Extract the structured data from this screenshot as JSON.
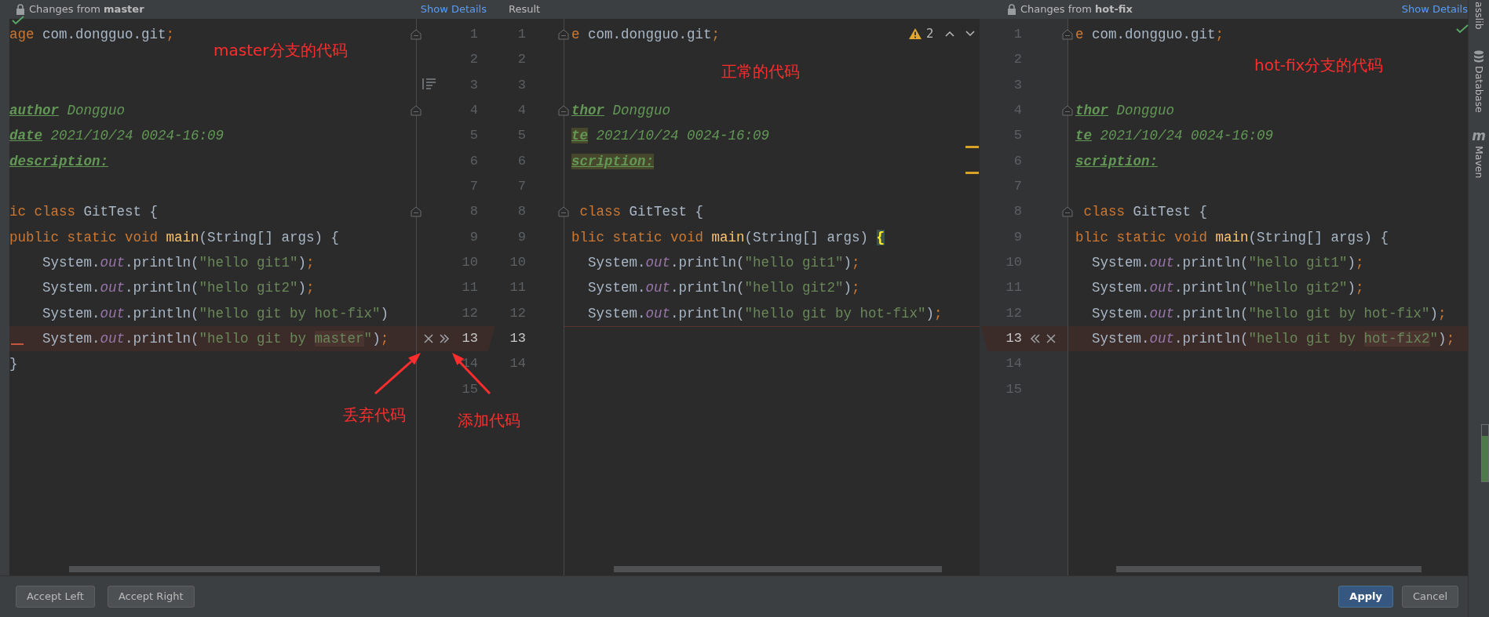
{
  "left_header": {
    "title": "Changes from **master**",
    "link": "Show Details"
  },
  "result_header": {
    "title": "Result"
  },
  "right_header": {
    "title": "Changes from **hot-fix**",
    "link": "Show Details"
  },
  "left_pane": {
    "lines": [
      {
        "fold": true,
        "conflict": false,
        "segments": [
          {
            "text": "age",
            "kind": "kw"
          },
          {
            "text": " com.dongguo.git",
            "kind": "plain"
          },
          {
            "text": ";",
            "kind": "punct"
          }
        ]
      },
      {
        "fold": false,
        "conflict": false
      },
      {
        "fold": false,
        "conflict": false
      },
      {
        "fold": true,
        "conflict": false,
        "segments": [
          {
            "text": "author",
            "kind": "doctag"
          },
          {
            "text": " Dongguo",
            "kind": "doc"
          }
        ]
      },
      {
        "fold": false,
        "conflict": false,
        "segments": [
          {
            "text": "date",
            "kind": "doctag"
          },
          {
            "text": " 2021/10/24 0024-16:09",
            "kind": "doc"
          }
        ]
      },
      {
        "fold": false,
        "conflict": false,
        "segments": [
          {
            "text": "description:",
            "kind": "doctag"
          }
        ]
      },
      {
        "fold": false,
        "conflict": false
      },
      {
        "fold": true,
        "conflict": false,
        "segments": [
          {
            "text": "ic class ",
            "kind": "kw"
          },
          {
            "text": "GitTest {",
            "kind": "plain"
          }
        ]
      },
      {
        "fold": false,
        "conflict": false,
        "segments": [
          {
            "text": "public static void ",
            "kind": "kw"
          },
          {
            "text": "main",
            "kind": "fn"
          },
          {
            "text": "(String[] args) {",
            "kind": "plain"
          }
        ]
      },
      {
        "fold": false,
        "conflict": false,
        "segments": [
          {
            "text": "    System.",
            "kind": "plain"
          },
          {
            "text": "out",
            "kind": "field"
          },
          {
            "text": ".println(",
            "kind": "plain"
          },
          {
            "text": "\"hello git1\"",
            "kind": "str"
          },
          {
            "text": ")",
            "kind": "plain"
          },
          {
            "text": ";",
            "kind": "punct"
          }
        ]
      },
      {
        "fold": false,
        "conflict": false,
        "segments": [
          {
            "text": "    System.",
            "kind": "plain"
          },
          {
            "text": "out",
            "kind": "field"
          },
          {
            "text": ".println(",
            "kind": "plain"
          },
          {
            "text": "\"hello git2\"",
            "kind": "str"
          },
          {
            "text": ")",
            "kind": "plain"
          },
          {
            "text": ";",
            "kind": "punct"
          }
        ]
      },
      {
        "fold": false,
        "conflict": false,
        "segments": [
          {
            "text": "    System.",
            "kind": "plain"
          },
          {
            "text": "out",
            "kind": "field"
          },
          {
            "text": ".println(",
            "kind": "plain"
          },
          {
            "text": "\"hello git by hot-fix\"",
            "kind": "str"
          },
          {
            "text": ")",
            "kind": "plain"
          }
        ]
      },
      {
        "fold": false,
        "conflict": true,
        "segments": [
          {
            "text": "    System.",
            "kind": "plain"
          },
          {
            "text": "out",
            "kind": "field"
          },
          {
            "text": ".println(",
            "kind": "plain"
          },
          {
            "text": "\"hello git by ",
            "kind": "str"
          },
          {
            "text": "master",
            "kind": "strmark"
          },
          {
            "text": "\"",
            "kind": "str"
          },
          {
            "text": ")",
            "kind": "plain"
          },
          {
            "text": ";",
            "kind": "punct"
          }
        ]
      },
      {
        "fold": false,
        "conflict": false,
        "segments": [
          {
            "text": "}",
            "kind": "plain"
          }
        ]
      }
    ]
  },
  "left_gutter": {
    "rows": [
      {
        "left_no": "1",
        "result_no": "1",
        "conflict": false
      },
      {
        "left_no": "2",
        "result_no": "2",
        "conflict": false
      },
      {
        "left_no": "3",
        "result_no": "3",
        "conflict": false
      },
      {
        "left_no": "4",
        "result_no": "4",
        "conflict": false
      },
      {
        "left_no": "5",
        "result_no": "5",
        "conflict": false
      },
      {
        "left_no": "6",
        "result_no": "6",
        "conflict": false
      },
      {
        "left_no": "7",
        "result_no": "7",
        "conflict": false
      },
      {
        "left_no": "8",
        "result_no": "8",
        "conflict": false
      },
      {
        "left_no": "9",
        "result_no": "9",
        "conflict": false
      },
      {
        "left_no": "10",
        "result_no": "10",
        "conflict": false
      },
      {
        "left_no": "11",
        "result_no": "11",
        "conflict": false
      },
      {
        "left_no": "12",
        "result_no": "12",
        "conflict": false
      },
      {
        "left_no": "13",
        "result_no": "13",
        "conflict": true
      },
      {
        "left_no": "14",
        "result_no": "14",
        "conflict": false
      },
      {
        "left_no": "15",
        "conflict": false
      }
    ]
  },
  "result_pane": {
    "warnings": "2",
    "lines": [
      {
        "fold": true,
        "conflict": false,
        "marked": false,
        "segments": [
          {
            "text": "e",
            "kind": "kw"
          },
          {
            "text": " com.dongguo.git",
            "kind": "plain"
          },
          {
            "text": ";",
            "kind": "punct"
          }
        ]
      },
      {
        "fold": false,
        "conflict": false,
        "marked": false
      },
      {
        "fold": false,
        "conflict": false,
        "marked": false
      },
      {
        "fold": true,
        "conflict": false,
        "marked": false,
        "segments": [
          {
            "text": "thor",
            "kind": "doctag"
          },
          {
            "text": " Dongguo",
            "kind": "doc"
          }
        ]
      },
      {
        "fold": false,
        "conflict": false,
        "marked": true,
        "segments": [
          {
            "text": "te",
            "kind": "doctagmark"
          },
          {
            "text": " 2021/10/24 0024-16:09",
            "kind": "doc"
          }
        ]
      },
      {
        "fold": false,
        "conflict": false,
        "marked": true,
        "segments": [
          {
            "text": "scription:",
            "kind": "doctagmark"
          }
        ]
      },
      {
        "fold": false,
        "conflict": false,
        "marked": false
      },
      {
        "fold": true,
        "conflict": false,
        "marked": false,
        "segments": [
          {
            "text": " class ",
            "kind": "kw"
          },
          {
            "text": "GitTest {",
            "kind": "plain"
          }
        ]
      },
      {
        "fold": false,
        "conflict": false,
        "marked": false,
        "segments": [
          {
            "text": "blic static void ",
            "kind": "kw"
          },
          {
            "text": "main",
            "kind": "fn"
          },
          {
            "text": "(String[] args) ",
            "kind": "plain"
          },
          {
            "text": "{",
            "kind": "brace"
          }
        ]
      },
      {
        "fold": false,
        "conflict": false,
        "marked": false,
        "segments": [
          {
            "text": "  System.",
            "kind": "plain"
          },
          {
            "text": "out",
            "kind": "field"
          },
          {
            "text": ".println(",
            "kind": "plain"
          },
          {
            "text": "\"hello git1\"",
            "kind": "str"
          },
          {
            "text": ")",
            "kind": "plain"
          },
          {
            "text": ";",
            "kind": "punct"
          }
        ]
      },
      {
        "fold": false,
        "conflict": false,
        "marked": false,
        "segments": [
          {
            "text": "  System.",
            "kind": "plain"
          },
          {
            "text": "out",
            "kind": "field"
          },
          {
            "text": ".println(",
            "kind": "plain"
          },
          {
            "text": "\"hello git2\"",
            "kind": "str"
          },
          {
            "text": ")",
            "kind": "plain"
          },
          {
            "text": ";",
            "kind": "punct"
          }
        ]
      },
      {
        "fold": false,
        "conflict": false,
        "marked": false,
        "segments": [
          {
            "text": "  System.",
            "kind": "plain"
          },
          {
            "text": "out",
            "kind": "field"
          },
          {
            "text": ".println(",
            "kind": "plain"
          },
          {
            "text": "\"hello git by hot-fix\"",
            "kind": "str"
          },
          {
            "text": ")",
            "kind": "plain"
          },
          {
            "text": ";",
            "kind": "punct"
          }
        ]
      },
      {
        "fold": false,
        "conflict": true,
        "marked": false
      }
    ]
  },
  "right_gutter": {
    "rows": [
      {
        "no": "1",
        "conflict": false
      },
      {
        "no": "2",
        "conflict": false
      },
      {
        "no": "3",
        "conflict": false
      },
      {
        "no": "4",
        "conflict": false
      },
      {
        "no": "5",
        "conflict": false
      },
      {
        "no": "6",
        "conflict": false
      },
      {
        "no": "7",
        "conflict": false
      },
      {
        "no": "8",
        "conflict": false
      },
      {
        "no": "9",
        "conflict": false
      },
      {
        "no": "10",
        "conflict": false
      },
      {
        "no": "11",
        "conflict": false
      },
      {
        "no": "12",
        "conflict": false
      },
      {
        "no": "13",
        "conflict": true
      },
      {
        "no": "14",
        "conflict": false
      },
      {
        "no": "15",
        "conflict": false
      }
    ]
  },
  "right_pane": {
    "lines": [
      {
        "fold": true,
        "conflict": false,
        "segments": [
          {
            "text": "e",
            "kind": "kw"
          },
          {
            "text": " com.dongguo.git",
            "kind": "plain"
          },
          {
            "text": ";",
            "kind": "punct"
          }
        ]
      },
      {
        "fold": false,
        "conflict": false
      },
      {
        "fold": false,
        "conflict": false
      },
      {
        "fold": true,
        "conflict": false,
        "segments": [
          {
            "text": "thor",
            "kind": "doctag"
          },
          {
            "text": " Dongguo",
            "kind": "doc"
          }
        ]
      },
      {
        "fold": false,
        "conflict": false,
        "segments": [
          {
            "text": "te",
            "kind": "doctag"
          },
          {
            "text": " 2021/10/24 0024-16:09",
            "kind": "doc"
          }
        ]
      },
      {
        "fold": false,
        "conflict": false,
        "segments": [
          {
            "text": "scription:",
            "kind": "doctag"
          }
        ]
      },
      {
        "fold": false,
        "conflict": false
      },
      {
        "fold": true,
        "conflict": false,
        "segments": [
          {
            "text": " class ",
            "kind": "kw"
          },
          {
            "text": "GitTest {",
            "kind": "plain"
          }
        ]
      },
      {
        "fold": false,
        "conflict": false,
        "segments": [
          {
            "text": "blic static void ",
            "kind": "kw"
          },
          {
            "text": "main",
            "kind": "fn"
          },
          {
            "text": "(String[] args) {",
            "kind": "plain"
          }
        ]
      },
      {
        "fold": false,
        "conflict": false,
        "segments": [
          {
            "text": "  System.",
            "kind": "plain"
          },
          {
            "text": "out",
            "kind": "field"
          },
          {
            "text": ".println(",
            "kind": "plain"
          },
          {
            "text": "\"hello git1\"",
            "kind": "str"
          },
          {
            "text": ")",
            "kind": "plain"
          },
          {
            "text": ";",
            "kind": "punct"
          }
        ]
      },
      {
        "fold": false,
        "conflict": false,
        "segments": [
          {
            "text": "  System.",
            "kind": "plain"
          },
          {
            "text": "out",
            "kind": "field"
          },
          {
            "text": ".println(",
            "kind": "plain"
          },
          {
            "text": "\"hello git2\"",
            "kind": "str"
          },
          {
            "text": ")",
            "kind": "plain"
          },
          {
            "text": ";",
            "kind": "punct"
          }
        ]
      },
      {
        "fold": false,
        "conflict": false,
        "segments": [
          {
            "text": "  System.",
            "kind": "plain"
          },
          {
            "text": "out",
            "kind": "field"
          },
          {
            "text": ".println(",
            "kind": "plain"
          },
          {
            "text": "\"hello git by hot-fix\"",
            "kind": "str"
          },
          {
            "text": ")",
            "kind": "plain"
          },
          {
            "text": ";",
            "kind": "punct"
          }
        ]
      },
      {
        "fold": false,
        "conflict": true,
        "segments": [
          {
            "text": "  System.",
            "kind": "plain"
          },
          {
            "text": "out",
            "kind": "field"
          },
          {
            "text": ".println(",
            "kind": "plain"
          },
          {
            "text": "\"hello git by ",
            "kind": "str"
          },
          {
            "text": "hot-fix2",
            "kind": "strmark"
          },
          {
            "text": "\"",
            "kind": "str"
          },
          {
            "text": ")",
            "kind": "plain"
          },
          {
            "text": ";",
            "kind": "punct"
          }
        ]
      }
    ]
  },
  "annotations": [
    {
      "text": "master分支的代码"
    },
    {
      "text": "正常的代码"
    },
    {
      "text": "hot-fix分支的代码"
    },
    {
      "text": "丢弃代码"
    },
    {
      "text": "添加代码"
    }
  ],
  "tool_strip": [
    {
      "label": "asslib"
    },
    {
      "label": "Database"
    },
    {
      "glyph": "m",
      "label": "Maven"
    }
  ],
  "footer": {
    "left_buttons": [
      "Accept Left",
      "Accept Right"
    ],
    "right_buttons": [
      {
        "label": "Apply",
        "primary": true
      },
      {
        "label": "Cancel",
        "primary": false
      }
    ]
  }
}
